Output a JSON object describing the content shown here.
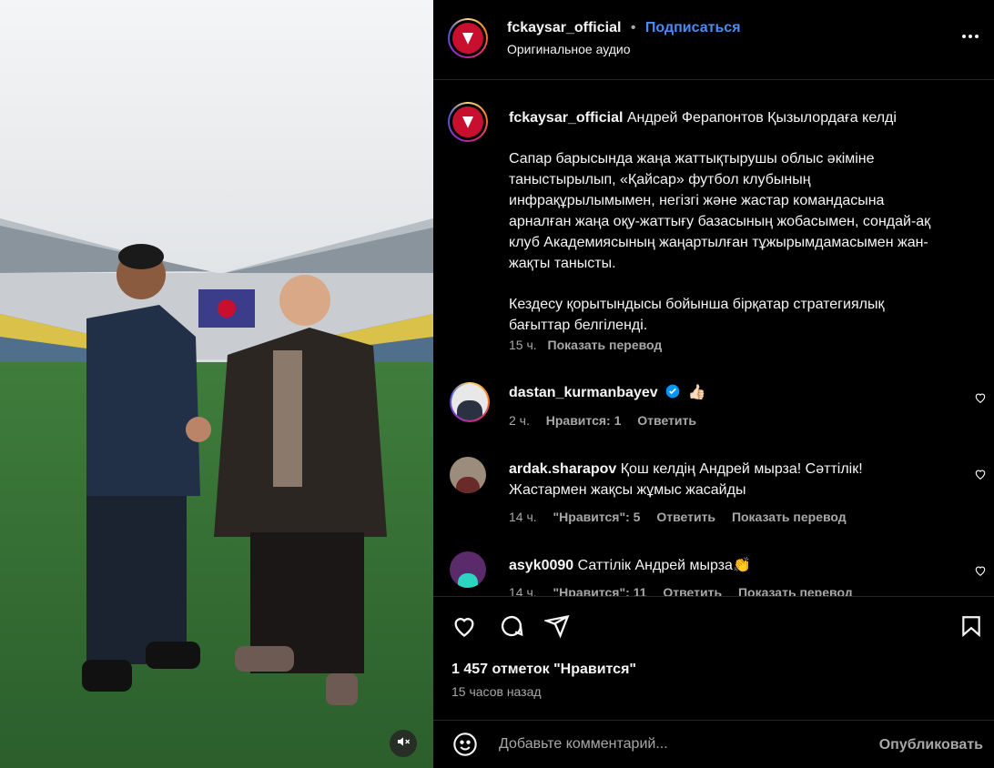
{
  "post": {
    "username": "fckaysar_official",
    "dot": "•",
    "follow_label": "Подписаться",
    "audio": "Оригинальное аудио"
  },
  "caption": {
    "username": "fckaysar_official",
    "title": "Андрей Ферапонтов Қызылордаға келді",
    "paragraph1": "Сапар барысында жаңа жаттықтырушы облыс әкіміне таныстырылып, «Қайсар» футбол клубының инфрақұрылымымен, негізгі және жастар командасына арналған жаңа оқу-жаттығу базасының жобасымен, сондай-ақ клуб Академиясының жаңартылған тұжырымдамасымен жан-жақты танысты.",
    "paragraph2": "Кездесу қорытындысы бойынша бірқатар стратегиялық бағыттар белгіленді.",
    "time": "15 ч.",
    "translate": "Показать перевод"
  },
  "comments": [
    {
      "username": "dastan_kurmanbayev",
      "text": "👍🏻",
      "time": "2 ч.",
      "likes": "Нравится: 1",
      "reply": "Ответить",
      "translate": ""
    },
    {
      "username": "ardak.sharapov",
      "text": "Қош келдің Андрей мырза! Сәттілік! Жастармен жақсы жұмыс жасайды",
      "time": "14 ч.",
      "likes": "\"Нравится\": 5",
      "reply": "Ответить",
      "translate": "Показать перевод"
    },
    {
      "username": "asyk0090",
      "text": "Саттілік Андрей мырза👏",
      "time": "14 ч.",
      "likes": "\"Нравится\": 11",
      "reply": "Ответить",
      "translate": "Показать перевод"
    }
  ],
  "footer": {
    "likes": "1 457 отметок \"Нравится\"",
    "time_ago": "15 часов назад",
    "comment_placeholder": "Добавьте комментарий...",
    "publish": "Опубликовать"
  },
  "icons": {
    "like": "heart-icon",
    "comment": "comment-icon",
    "share": "share-icon",
    "save": "bookmark-icon",
    "more": "more-icon",
    "mute": "muted-speaker-icon",
    "emoji": "emoji-icon",
    "verified": "verified-badge-icon"
  },
  "colors": {
    "accent": "#4a8cf5",
    "background": "#000000",
    "text": "#f5f5f5",
    "muted": "#a8a8a8",
    "brand_red": "#c8102e"
  }
}
